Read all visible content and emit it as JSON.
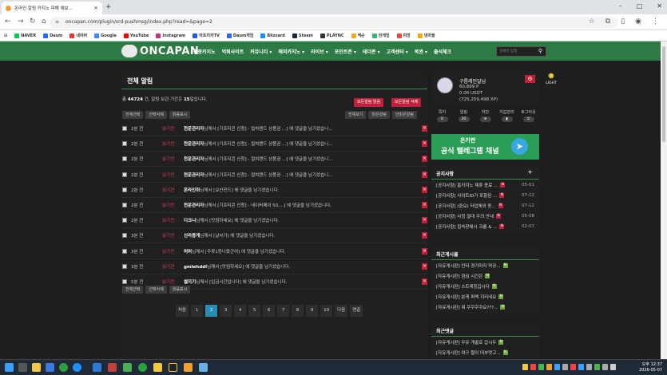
{
  "browser": {
    "tab_title": "온라인 알림 카지노 피해 예보...",
    "url": "oncapan.com/plugin/srd-pushmsg/index.php?read=&page=2",
    "bookmarks": [
      "NAVER",
      "Daum",
      "네이버",
      "Google",
      "YouTube",
      "Instagram",
      "아프리카TV",
      "Daum게임",
      "Blizzard",
      "Steam",
      "PLAYNC",
      "넥슨",
      "한게임",
      "피망",
      "넷마블"
    ]
  },
  "site": {
    "logo_text": "ONCAPAN",
    "menu": [
      "검증카지노",
      "먹튀사이트",
      "커뮤니티 ▾",
      "해외카지노 ▾",
      "라이브 ▾",
      "포인트존 ▾",
      "테더존 ▾",
      "고객센터 ▾",
      "복권 ▾",
      "출석체크"
    ],
    "search_placeholder": "검색어 입력"
  },
  "page": {
    "title": "전체 알림",
    "summary_prefix": "총",
    "total": "44724",
    "summary_middle": "건, 알림 보관 기간은",
    "keep_days": "15",
    "summary_suffix": "일입니다.",
    "read_all_button": "모든알림 읽음",
    "delete_all_button": "모든알림 삭제",
    "select_all": "전체선택",
    "delete_selected": "선택삭제",
    "mark_read": "읽음표시",
    "filter_all": "전체보기",
    "filter_read": "읽은알림",
    "filter_unread": "안읽은알림",
    "rows": [
      {
        "time": "2분 전",
        "status": "읽기전",
        "user": "천운관리자",
        "text": "님께서 [기프티콘 신청] - 컬쳐랜드 상품권 ...] 에 댓글을 남기셨습니..."
      },
      {
        "time": "2분 전",
        "status": "읽기전",
        "user": "천운관리자",
        "text": "님께서 [기프티콘 신청] - 컬쳐랜드 상품권 ...] 에 댓글을 남기셨습니..."
      },
      {
        "time": "2분 전",
        "status": "읽기전",
        "user": "천운관리자",
        "text": "님께서 [기프티콘 신청] - 컬쳐랜드 상품권 ...] 에 댓글을 남기셨습니..."
      },
      {
        "time": "2분 전",
        "status": "읽기전",
        "user": "천운관리자",
        "text": "님께서 [기프티콘 신청] - 컬쳐랜드 상품권 ...] 에 댓글을 남기셨습니..."
      },
      {
        "time": "2분 전",
        "status": "읽기전",
        "user": "온라인쥐",
        "text": "님께서 [요산진드] 에 댓글을 남기셨습니다."
      },
      {
        "time": "2분 전",
        "status": "읽기전",
        "user": "천운관리자",
        "text": "님께서 [기프티콘 신청] - 네이버페이 50,...] 에 댓글을 남기셨습니다."
      },
      {
        "time": "2분 전",
        "status": "읽기전",
        "user": "디크니",
        "text": "님께서 [맛점하세요] 에 댓글을 남기셨습니다."
      },
      {
        "time": "3분 전",
        "status": "읽기전",
        "user": "신라용게",
        "text": "님께서 [날씨가] 에 댓글을 남기셨습니다."
      },
      {
        "time": "3분 전",
        "status": "읽기전",
        "user": "머머",
        "text": "님께서 [주류1등나왔군여] 에 댓글을 남기셨습니다."
      },
      {
        "time": "3분 전",
        "status": "읽기전",
        "user": "gmlehddl",
        "text": "님께서 [맛점하세요] 에 댓글을 남기셨습니다."
      },
      {
        "time": "5분 전",
        "status": "읽기전",
        "user": "썰지기",
        "text": "님께서 [입금시간입니다] 에 댓글을 남기셨습니다."
      }
    ],
    "pages": [
      "처음",
      "1",
      "2",
      "3",
      "4",
      "5",
      "6",
      "7",
      "8",
      "9",
      "10",
      "다음",
      "맨끝"
    ],
    "current_page": "2"
  },
  "sidebar": {
    "username": "구름레인달님",
    "points": "60,899 P",
    "usdt": "0.00 USDT",
    "xp": "(725,259,498 XP)",
    "quick": [
      {
        "label": "쪽지",
        "badge": "0"
      },
      {
        "label": "알림",
        "badge": "20"
      },
      {
        "label": "자단",
        "badge": "⊘"
      },
      {
        "label": "지갑관리",
        "badge": "▮"
      },
      {
        "label": "로그아웃",
        "badge": "⏻"
      }
    ],
    "banner_line1": "온카판",
    "banner_line2": "공식 텔레그램 채널",
    "light_label": "LIGHT",
    "notice_title": "공지사항",
    "notices": [
      {
        "text": "[공지사항] 홈카지노 제휴 종료 ...",
        "date": "05-01"
      },
      {
        "text": "[공지사항] 사이트ID가 포함된 ...",
        "date": "07-12"
      },
      {
        "text": "[공지사항] (중요) 타업체와 동...",
        "date": "07-12"
      },
      {
        "text": "[공지사항] 사칭 절대 주의 안내",
        "date": "05-08"
      },
      {
        "text": "[공지사항] 접속장애시 크롬 & ...",
        "date": "02-07"
      }
    ],
    "recent_posts_title": "최근게시물",
    "recent_posts": [
      "[자유게시판] 인터 경기마자 막공...",
      "[자유게시판] 점심 시간은",
      "[자유게시판] 스트레칭갑시다",
      "[자유게시판] 분게 퍼랙 지리네요",
      "[자유게시판] 뭐 쿠쿠쿠쿠요???..."
    ],
    "recent_comments_title": "최근댓글",
    "recent_comments": [
      "[자유게시판] 우유 개꿀로 갑시두",
      "[자유게시판] 여구 짤이 떠부멋고..."
    ]
  },
  "taskbar": {
    "time": "오후 12:37",
    "date": "2026-05-07"
  }
}
